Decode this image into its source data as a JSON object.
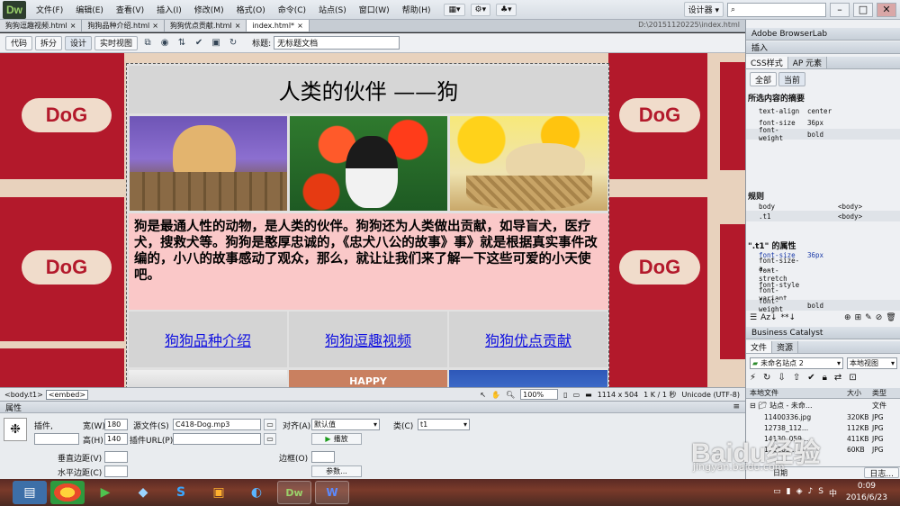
{
  "app": {
    "logo": "Dw",
    "menus": [
      "文件(F)",
      "编辑(E)",
      "查看(V)",
      "插入(I)",
      "修改(M)",
      "格式(O)",
      "命令(C)",
      "站点(S)",
      "窗口(W)",
      "帮助(H)"
    ],
    "workspace": "设计器",
    "window_controls": [
      "–",
      "□",
      "✕"
    ]
  },
  "doc_tabs": [
    {
      "label": "狗狗逗趣视频.html",
      "active": false
    },
    {
      "label": "狗狗品种介绍.html",
      "active": false
    },
    {
      "label": "狗狗优点贡献.html",
      "active": false
    },
    {
      "label": "index.html*",
      "active": true
    }
  ],
  "file_path": "D:\\20151120225\\index.html",
  "doc_toolbar": {
    "views": [
      {
        "label": "代码",
        "active": false
      },
      {
        "label": "拆分",
        "active": false
      },
      {
        "label": "设计",
        "active": true
      },
      {
        "label": "实时视图",
        "active": false
      }
    ],
    "title_label": "标题:",
    "title_value": "无标题文档"
  },
  "design": {
    "bg_word": "DoG",
    "heading": "人类的伙伴 ——狗",
    "description": "狗是最通人性的动物，是人类的伙伴。狗狗还为人类做出贡献，如导盲犬，医疗犬，搜救犬等。狗狗是憨厚忠诚的，《忠犬八公的故事》事》就是根据真实事件改编的，小八的故事感动了观众，那么，就让让我们来了解一下这些可爱的小天使吧。",
    "nav_links": [
      "狗狗品种介绍",
      "狗狗逗趣视频",
      "狗狗优点贡献"
    ],
    "bottom_text": "HAPPY"
  },
  "statusbar": {
    "tags": [
      "<body.t1>",
      "<embed>"
    ],
    "zoom": "100%",
    "size": "1114 x 504",
    "filesize": "1 K / 1 秒",
    "encoding": "Unicode (UTF-8)"
  },
  "properties": {
    "header": "属性",
    "plugin_label": "插件,",
    "width_label": "宽(W)",
    "width_value": "180",
    "height_label": "高(H)",
    "height_value": "140",
    "src_label": "源文件(S)",
    "src_value": "C418-Dog.mp3",
    "pluginurl_label": "插件URL(P)",
    "align_label": "对齐(A)",
    "align_value": "默认值",
    "class_label": "类(C)",
    "class_value": "t1",
    "play_label": "播放",
    "vspace_label": "垂直边距(V)",
    "hspace_label": "水平边距(C)",
    "border_label": "边框(O)",
    "params_label": "参数..."
  },
  "right_panel": {
    "browserlab": "Adobe BrowserLab",
    "insert": "插入",
    "css_tabs": [
      {
        "label": "CSS样式",
        "active": true
      },
      {
        "label": "AP 元素",
        "active": false
      }
    ],
    "mode_tabs": [
      {
        "label": "全部",
        "active": false
      },
      {
        "label": "当前",
        "active": true
      }
    ],
    "summary_title": "所选内容的摘要",
    "summary": [
      {
        "k": "text-align",
        "v": "center"
      },
      {
        "k": "font-size",
        "v": "36px"
      },
      {
        "k": "font-weight",
        "v": "bold"
      }
    ],
    "rules_title": "规则",
    "rules": [
      {
        "k": "body",
        "v": "<body>"
      },
      {
        "k": ".t1",
        "v": "<body>"
      }
    ],
    "props_title": "\".t1\" 的属性",
    "props": [
      {
        "k": "font-size",
        "v": "36px"
      },
      {
        "k": "font-size-a...",
        "v": ""
      },
      {
        "k": "font-stretch",
        "v": ""
      },
      {
        "k": "font-style",
        "v": ""
      },
      {
        "k": "font-variant",
        "v": ""
      },
      {
        "k": "font-weight",
        "v": "bold"
      }
    ],
    "business_catalyst": "Business Catalyst",
    "files_tabs": [
      {
        "label": "文件",
        "active": true
      },
      {
        "label": "资源",
        "active": false
      }
    ],
    "site_select": "未命名站点 2",
    "view_select": "本地视图",
    "col_local": "本地文件",
    "col_size": "大小",
    "col_type": "类型",
    "site_root": "站点 - 未命...",
    "site_root_type": "文件",
    "files": [
      {
        "name": "11400336.jpg",
        "size": "320KB",
        "type": "JPG"
      },
      {
        "name": "12738_112...",
        "size": "112KB",
        "type": "JPG"
      },
      {
        "name": "14130_059...",
        "size": "411KB",
        "type": "JPG"
      },
      {
        "name": "170205...",
        "size": "60KB",
        "type": "JPG"
      }
    ],
    "date_label": "日期",
    "log_label": "日志..."
  },
  "taskbar": {
    "time": "0:09",
    "date": "2016/6/23"
  },
  "watermark": {
    "brand": "Baidu经验",
    "url": "jingyan.baidu.com"
  },
  "colors": {
    "dog_red": "#b3192b",
    "desc_pink": "#fac8c8",
    "link_blue": "#1010e0"
  }
}
